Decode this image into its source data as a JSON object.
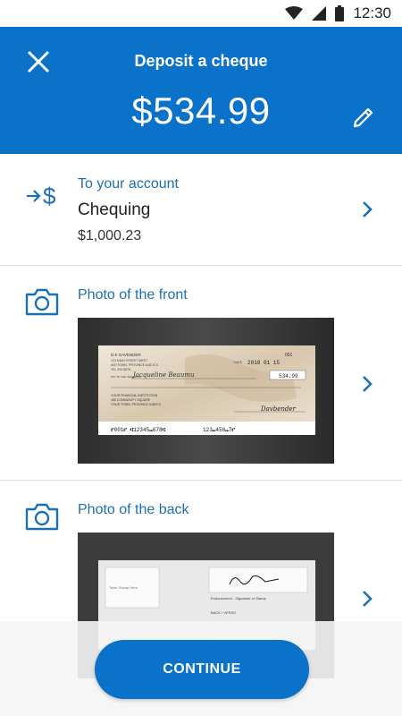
{
  "status_bar": {
    "time": "12:30"
  },
  "header": {
    "title": "Deposit a cheque",
    "amount": "$534.99"
  },
  "account": {
    "label": "To your account",
    "name": "Chequing",
    "balance": "$1,000.23"
  },
  "front_photo": {
    "label": "Photo of the front"
  },
  "back_photo": {
    "label": "Photo of the back"
  },
  "cheque_front": {
    "owner": "D.K GAVENDER",
    "address1": "123 MAIN STREET WEST",
    "address2": "ANYTOWN, PROVINCE A1B 2C4",
    "phone": "TEL 234-5678",
    "number": "001",
    "date_label": "DATE",
    "date": "2018 01 15",
    "payto_label": "PAY TO THE ORDER OF",
    "payee": "Jacqueline Beaumu",
    "amount": "534.99",
    "bank1": "YOUR FINANCIAL INSTITUTION",
    "bank2": "456 COMMUNITY SQUARE",
    "bank3": "YOUR TOWN, PROVINCE A1B2C3",
    "signature": "Davbender",
    "micr1": "⑈001⑈ ⑆12345⑉678⑆",
    "micr2": "123⑉456⑉7⑈"
  },
  "cheque_back": {
    "stamp_note": "Teller Stamp Here",
    "endorse": "Endorsement - Signature or Stamp",
    "verso": "BACK / VERSO"
  },
  "continue_label": "CONTINUE"
}
